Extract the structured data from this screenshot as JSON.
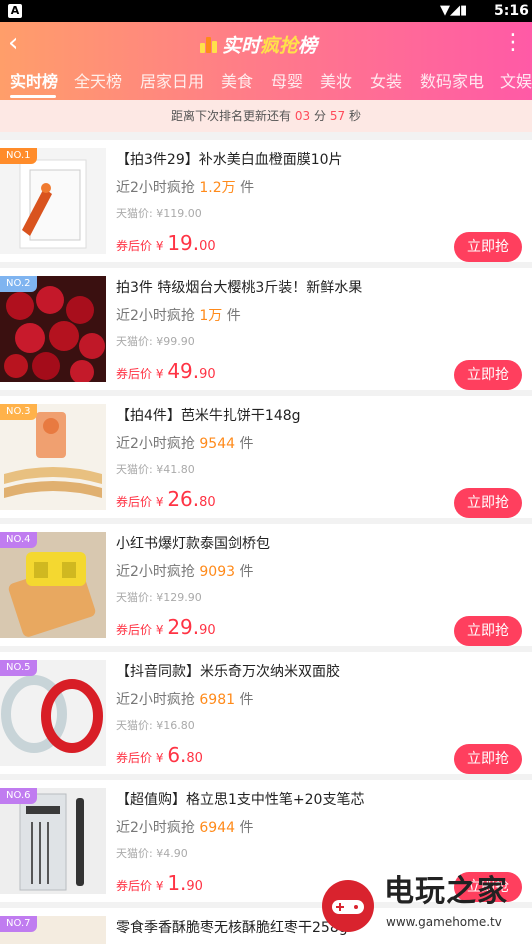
{
  "status_bar": {
    "app_icon": "A",
    "time": "5:16"
  },
  "header": {
    "back_icon": "chevron-left",
    "title_prefix": "实时",
    "title_highlight": "疯抢",
    "title_suffix": "榜",
    "more_icon": "vertical-dots",
    "accent_color": "#ff5aa6"
  },
  "tabs": [
    "实时榜",
    "全天榜",
    "居家日用",
    "美食",
    "母婴",
    "美妆",
    "女装",
    "数码家电",
    "文娱"
  ],
  "countdown": {
    "prefix": "距离下次排名更新还有",
    "minutes": "03",
    "min_unit": "分",
    "seconds": "57",
    "sec_unit": "秒"
  },
  "items": [
    {
      "rank": "NO.1",
      "name": "【拍3件29】补水美白血橙面膜10片",
      "sold_prefix": "近2小时疯抢",
      "sold": "1.2万",
      "sold_unit": "件",
      "orig": "天猫价: ¥119.00",
      "price_label": "券后价",
      "currency": "¥",
      "price_int": "19.",
      "price_dec": "00",
      "buy": "立即抢"
    },
    {
      "rank": "NO.2",
      "name": "拍3件 特级烟台大樱桃3斤装！新鲜水果",
      "sold_prefix": "近2小时疯抢",
      "sold": "1万",
      "sold_unit": "件",
      "orig": "天猫价: ¥99.90",
      "price_label": "券后价",
      "currency": "¥",
      "price_int": "49.",
      "price_dec": "90",
      "buy": "立即抢"
    },
    {
      "rank": "NO.3",
      "name": "【拍4件】芭米牛扎饼干148g",
      "sold_prefix": "近2小时疯抢",
      "sold": "9544",
      "sold_unit": "件",
      "orig": "天猫价: ¥41.80",
      "price_label": "券后价",
      "currency": "¥",
      "price_int": "26.",
      "price_dec": "80",
      "buy": "立即抢"
    },
    {
      "rank": "NO.4",
      "name": "小红书爆灯款泰国剑桥包",
      "sold_prefix": "近2小时疯抢",
      "sold": "9093",
      "sold_unit": "件",
      "orig": "天猫价: ¥129.90",
      "price_label": "券后价",
      "currency": "¥",
      "price_int": "29.",
      "price_dec": "90",
      "buy": "立即抢"
    },
    {
      "rank": "NO.5",
      "name": "【抖音同款】米乐奇万次纳米双面胶",
      "sold_prefix": "近2小时疯抢",
      "sold": "6981",
      "sold_unit": "件",
      "orig": "天猫价: ¥16.80",
      "price_label": "券后价",
      "currency": "¥",
      "price_int": "6.",
      "price_dec": "80",
      "buy": "立即抢"
    },
    {
      "rank": "NO.6",
      "name": "【超值购】格立思1支中性笔+20支笔芯",
      "sold_prefix": "近2小时疯抢",
      "sold": "6944",
      "sold_unit": "件",
      "orig": "天猫价: ¥4.90",
      "price_label": "券后价",
      "currency": "¥",
      "price_int": "1.",
      "price_dec": "90",
      "buy": "立即抢"
    },
    {
      "rank": "NO.7",
      "name": "零食季香酥脆枣无核酥脆红枣干258g",
      "sold_prefix": "",
      "sold": "",
      "sold_unit": "",
      "orig": "",
      "price_label": "",
      "currency": "",
      "price_int": "",
      "price_dec": "",
      "buy": ""
    }
  ],
  "rank_colors": [
    "#ff8c2a",
    "#7fb4f0",
    "#ffb24a",
    "#c07cf0",
    "#c07cf0",
    "#c07cf0",
    "#c07cf0"
  ],
  "watermark": {
    "text": "电玩之家",
    "url": "www.gamehome.tv"
  }
}
